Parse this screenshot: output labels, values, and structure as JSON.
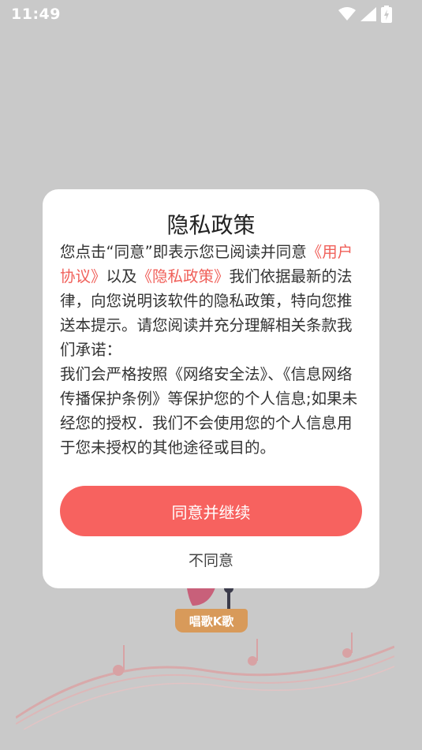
{
  "status_bar": {
    "time": "11:49",
    "icons": [
      "wifi-icon",
      "signal-icon",
      "battery-charging-icon"
    ]
  },
  "splash": {
    "logo_text": "唱歌K歌"
  },
  "dialog": {
    "title": "隐私政策",
    "body": {
      "part1": "您点击“同意”即表示您已阅读并同意",
      "link_user_agreement": "《用户协议》",
      "part2": "以及",
      "link_privacy_policy": "《隐私政策》",
      "part3": "我们依据最新的法律，向您说明该软件的隐私政策，特向您推送本提示。请您阅读并充分理解相关条款我们承诺：",
      "part4": "我们会严格按照《网络安全法》、《信息网络传播保护条例》等保护您的个人信息;如果未经您的授权．我们不会使用您的个人信息用于您未授权的其他途径或目的。"
    },
    "agree_label": "同意并继续",
    "disagree_label": "不同意"
  },
  "colors": {
    "accent": "#f7625f",
    "link": "#f0605a",
    "overlay_bg": "#c9c9c9"
  }
}
